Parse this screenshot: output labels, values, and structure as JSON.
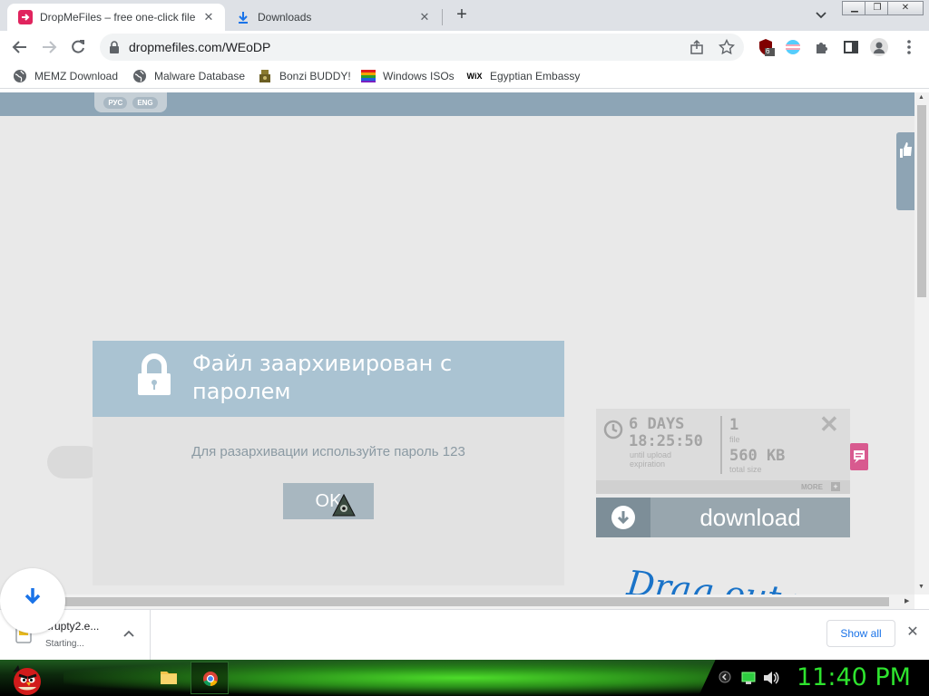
{
  "tabs": [
    {
      "title": "DropMeFiles – free one-click file",
      "icon": "dropmefiles-icon",
      "active": true
    },
    {
      "title": "Downloads",
      "icon": "download-icon",
      "active": false
    }
  ],
  "address": {
    "url": "dropmefiles.com/WEoDP"
  },
  "extensions": {
    "badge_count": "6"
  },
  "bookmarks": [
    {
      "label": "MEMZ Download",
      "icon": "globe-icon"
    },
    {
      "label": "Malware Database",
      "icon": "globe-icon"
    },
    {
      "label": "Bonzi BUDDY!",
      "icon": "bonzi-icon"
    },
    {
      "label": "Windows ISOs",
      "icon": "windows-flag-icon"
    },
    {
      "label": "Egyptian Embassy",
      "icon": "wix-icon",
      "icon_text": "WiX"
    }
  ],
  "page": {
    "lang_ru": "РУС",
    "lang_en": "ENG",
    "modal": {
      "title": "Файл заархивирован с паролем",
      "message": "Для разархивации используйте пароль 123",
      "ok": "OK"
    },
    "upload": {
      "days": "6 DAYS",
      "time": "18:25:50",
      "until_line1": "until upload",
      "until_line2": "expiration",
      "file_count": "1",
      "file_label": "file",
      "size": "560 KB",
      "size_label": "total size",
      "more": "MORE"
    },
    "download_label": "download",
    "drag_text": "Drag out your"
  },
  "download_shelf": {
    "filename": "crupty2.e...",
    "status": "Starting...",
    "show_all": "Show all"
  },
  "taskbar": {
    "clock": "11:40 PM"
  },
  "colors": {
    "header_blue": "#8da5b6",
    "modal_header": "#aac3d2",
    "download_button": "#98a6ae",
    "clock_green": "#2ee32e",
    "link_blue": "#1a73e8"
  }
}
